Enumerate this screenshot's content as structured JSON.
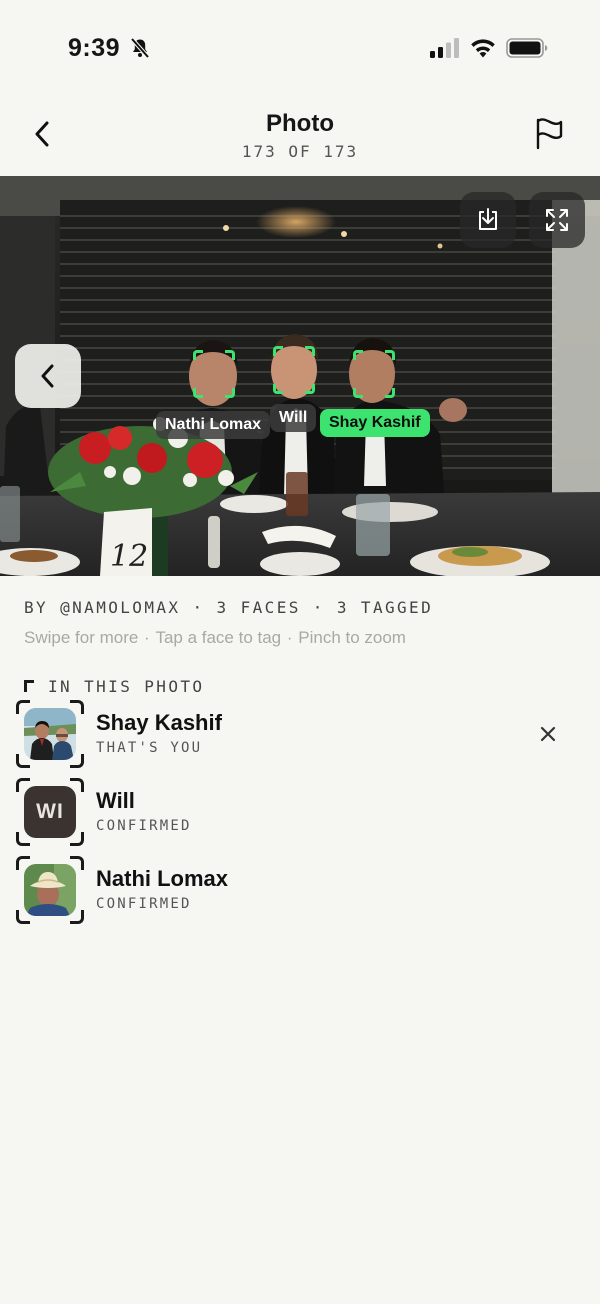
{
  "status_bar": {
    "time": "9:39",
    "icons": [
      "bell-slash-icon",
      "signal-icon",
      "wifi-icon",
      "battery-icon"
    ]
  },
  "header": {
    "title": "Photo",
    "counter": "173 OF 173",
    "back_icon": "chevron-left-icon",
    "report_icon": "flag-icon"
  },
  "photo": {
    "controls": [
      "download-icon",
      "fullscreen-icon",
      "chevron-left-icon"
    ],
    "face_tags": [
      {
        "label": "Nathi Lomax",
        "active": false
      },
      {
        "label": "Will",
        "active": false
      },
      {
        "label": "Shay Kashif",
        "active": true
      }
    ],
    "table_card_number": "12"
  },
  "meta": {
    "byline": "BY @NAMOLOMAX · 3 FACES · 3 TAGGED",
    "hint_swipe": "Swipe for more",
    "hint_tap": "Tap a face to tag",
    "hint_pinch": "Pinch to zoom"
  },
  "in_this_photo": {
    "label": "IN THIS PHOTO",
    "people": [
      {
        "name": "Shay Kashif",
        "status": "THAT'S YOU",
        "avatar": "photo",
        "removable": true
      },
      {
        "name": "Will",
        "status": "CONFIRMED",
        "avatar": "initials",
        "initials": "WI"
      },
      {
        "name": "Nathi Lomax",
        "status": "CONFIRMED",
        "avatar": "photo"
      }
    ]
  },
  "colors": {
    "background": "#f6f6f2",
    "accent_green": "#3de36f",
    "text_primary": "#111111",
    "text_muted": "#a9a9a4"
  }
}
